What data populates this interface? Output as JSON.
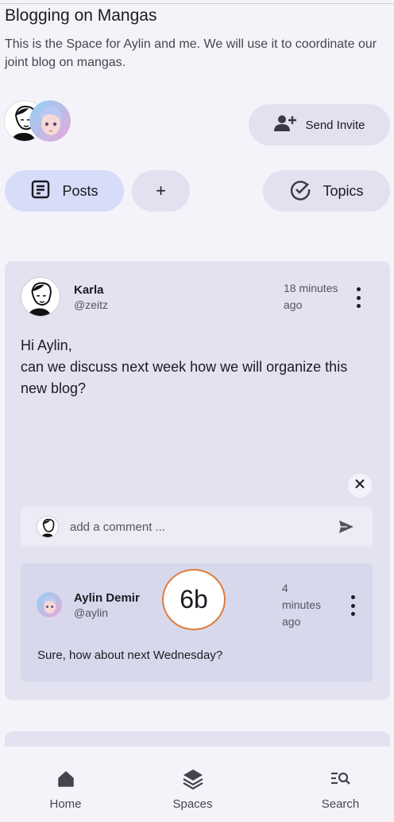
{
  "space": {
    "title": "Blogging on Mangas",
    "description": "This is the Space for Aylin and me. We will use it to coordinate our joint blog on mangas."
  },
  "actions": {
    "invite_label": "Send Invite",
    "posts_label": "Posts",
    "add_label": "+",
    "topics_label": "Topics"
  },
  "post": {
    "author_name": "Karla",
    "author_handle": "@zeitz",
    "time_line1": "18 minutes",
    "time_line2": "ago",
    "body_line1": "Hi Aylin,",
    "body_line2": "can we discuss next week how we will organize this new blog?"
  },
  "comment_input": {
    "placeholder": "add a comment ..."
  },
  "reply": {
    "author_name": "Aylin Demir",
    "author_handle": "@aylin",
    "time_line1": "4",
    "time_line2": "minutes",
    "time_line3": "ago",
    "body": "Sure, how about next Wednesday?"
  },
  "annotation_badge": "6b",
  "nav": {
    "home": "Home",
    "spaces": "Spaces",
    "search": "Search"
  },
  "colors": {
    "accent_pill": "#d7dcf9",
    "pill": "#e2e1ef",
    "card": "#e3e2f0",
    "badge_border": "#e07b39"
  },
  "icons": [
    "person-add-icon",
    "note-icon",
    "check-circle-icon",
    "more-vert-icon",
    "close-icon",
    "send-icon",
    "home-icon",
    "layers-icon",
    "search-list-icon"
  ]
}
